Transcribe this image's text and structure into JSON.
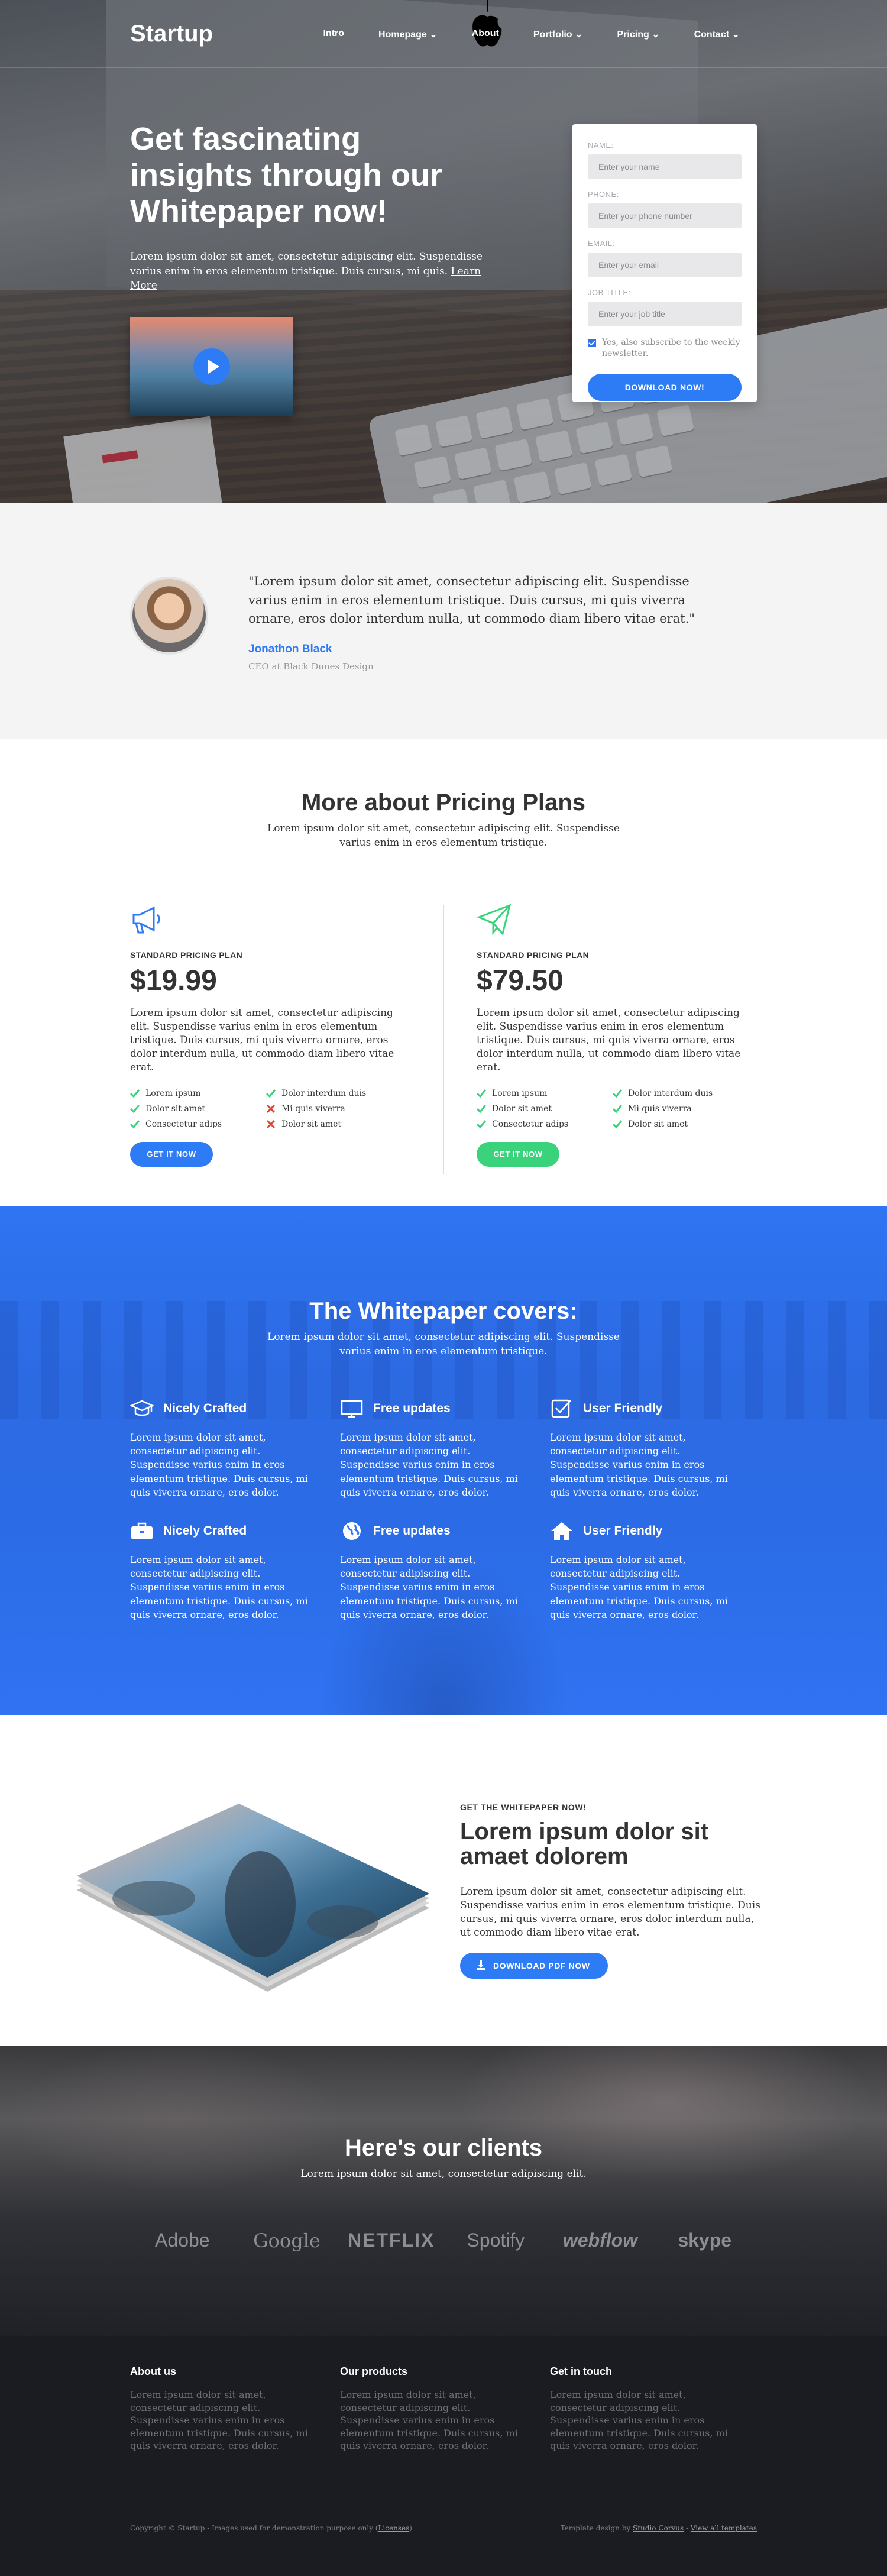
{
  "nav": {
    "logo": "Startup",
    "items": [
      "Intro",
      "Homepage ⌄",
      "About",
      "Portfolio ⌄",
      "Pricing ⌄",
      "Contact ⌄"
    ]
  },
  "hero": {
    "title": "Get fascinating insights through our Whitepaper now!",
    "text": "Lorem ipsum dolor sit amet, consectetur adipiscing elit. Suspendisse varius enim in eros elementum tristique. Duis cursus, mi quis. ",
    "link": "Learn More"
  },
  "form": {
    "name_label": "NAME:",
    "name_placeholder": "Enter your name",
    "phone_label": "PHONE:",
    "phone_placeholder": "Enter your phone number",
    "email_label": "EMAIL:",
    "email_placeholder": "Enter your email",
    "job_label": "JOB TITLE:",
    "job_placeholder": "Enter your job title",
    "subscribe": "Yes, also subscribe to the weekly newsletter.",
    "submit": "DOWNLOAD NOW!"
  },
  "testimonial": {
    "quote": "\"Lorem ipsum dolor sit amet, consectetur adipiscing elit. Suspendisse varius enim in eros elementum tristique. Duis cursus, mi quis viverra ornare, eros dolor interdum nulla, ut commodo diam libero vitae erat.\"",
    "name": "Jonathon Black",
    "role": "CEO at Black Dunes Design"
  },
  "pricing": {
    "title": "More about Pricing Plans",
    "subtitle": "Lorem ipsum dolor sit amet, consectetur adipiscing elit. Suspendisse varius enim in eros elementum tristique.",
    "plans": [
      {
        "name": "STANDARD PRICING PLAN",
        "price": "$19.99",
        "desc": "Lorem ipsum dolor sit amet, consectetur adipiscing elit. Suspendisse varius enim in eros elementum tristique. Duis cursus, mi quis viverra ornare, eros dolor interdum nulla, ut commodo diam libero vitae erat.",
        "features": [
          {
            "text": "Lorem ipsum",
            "ok": true
          },
          {
            "text": "Dolor interdum duis",
            "ok": true
          },
          {
            "text": "Dolor sit amet",
            "ok": true
          },
          {
            "text": "Mi quis viverra",
            "ok": false
          },
          {
            "text": "Consectetur adips",
            "ok": true
          },
          {
            "text": "Dolor sit amet",
            "ok": false
          }
        ],
        "button": "GET IT NOW",
        "color": "#2e7bf6"
      },
      {
        "name": "STANDARD PRICING PLAN",
        "price": "$79.50",
        "desc": "Lorem ipsum dolor sit amet, consectetur adipiscing elit. Suspendisse varius enim in eros elementum tristique. Duis cursus, mi quis viverra ornare, eros dolor interdum nulla, ut commodo diam libero vitae erat.",
        "features": [
          {
            "text": "Lorem ipsum",
            "ok": true
          },
          {
            "text": "Dolor interdum duis",
            "ok": true
          },
          {
            "text": "Dolor sit amet",
            "ok": true
          },
          {
            "text": "Mi quis viverra",
            "ok": true
          },
          {
            "text": "Consectetur adips",
            "ok": true
          },
          {
            "text": "Dolor sit amet",
            "ok": true
          }
        ],
        "button": "GET IT NOW",
        "color": "#3ad37c"
      }
    ]
  },
  "covers": {
    "title": "The Whitepaper covers:",
    "subtitle": "Lorem ipsum dolor sit amet, consectetur adipiscing elit. Suspendisse varius enim in eros elementum tristique.",
    "features": [
      {
        "title": "Nicely Crafted",
        "icon": "graduation-cap-icon",
        "text": "Lorem ipsum dolor sit amet, consectetur adipiscing elit. Suspendisse varius enim in eros elementum tristique. Duis cursus, mi quis viverra ornare, eros dolor."
      },
      {
        "title": "Free updates",
        "icon": "monitor-icon",
        "text": "Lorem ipsum dolor sit amet, consectetur adipiscing elit. Suspendisse varius enim in eros elementum tristique. Duis cursus, mi quis viverra ornare, eros dolor."
      },
      {
        "title": "User Friendly",
        "icon": "checkbox-icon",
        "text": "Lorem ipsum dolor sit amet, consectetur adipiscing elit. Suspendisse varius enim in eros elementum tristique. Duis cursus, mi quis viverra ornare, eros dolor."
      },
      {
        "title": "Nicely Crafted",
        "icon": "briefcase-icon",
        "text": "Lorem ipsum dolor sit amet, consectetur adipiscing elit. Suspendisse varius enim in eros elementum tristique. Duis cursus, mi quis viverra ornare, eros dolor."
      },
      {
        "title": "Free updates",
        "icon": "globe-icon",
        "text": "Lorem ipsum dolor sit amet, consectetur adipiscing elit. Suspendisse varius enim in eros elementum tristique. Duis cursus, mi quis viverra ornare, eros dolor."
      },
      {
        "title": "User Friendly",
        "icon": "home-icon",
        "text": "Lorem ipsum dolor sit amet, consectetur adipiscing elit. Suspendisse varius enim in eros elementum tristique. Duis cursus, mi quis viverra ornare, eros dolor."
      }
    ]
  },
  "download": {
    "kicker": "GET THE WHITEPAPER NOW!",
    "title": "Lorem ipsum dolor sit amaet dolorem",
    "text": "Lorem ipsum dolor sit amet, consectetur adipiscing elit. Suspendisse varius enim in eros elementum tristique. Duis cursus, mi quis viverra ornare, eros dolor interdum nulla, ut commodo diam libero vitae erat.",
    "button": "DOWNLOAD PDF NOW"
  },
  "clients": {
    "title": "Here's our clients",
    "subtitle": "Lorem ipsum dolor sit amet, consectetur adipiscing elit.",
    "logos": [
      "Adobe",
      "Google",
      "NETFLIX",
      "Spotify",
      "webflow",
      "skype"
    ]
  },
  "footer": {
    "columns": [
      {
        "title": "About us",
        "text": "Lorem ipsum dolor sit amet, consectetur adipiscing elit. Suspendisse varius enim in eros elementum tristique. Duis cursus, mi quis viverra ornare, eros dolor."
      },
      {
        "title": "Our products",
        "text": "Lorem ipsum dolor sit amet, consectetur adipiscing elit. Suspendisse varius enim in eros elementum tristique. Duis cursus, mi quis viverra ornare, eros dolor."
      },
      {
        "title": "Get in touch",
        "text": "Lorem ipsum dolor sit amet, consectetur adipiscing elit. Suspendisse varius enim in eros elementum tristique. Duis cursus, mi quis viverra ornare, eros dolor."
      }
    ],
    "copyright": "Copyright © Startup - Images used for demonstration purpose only (",
    "licenses": "Licenses",
    "copyright_end": ")",
    "credit": "Template design by ",
    "credit_link": "Studio Corvus",
    "sep": " - ",
    "all_templates": "View all templates"
  }
}
